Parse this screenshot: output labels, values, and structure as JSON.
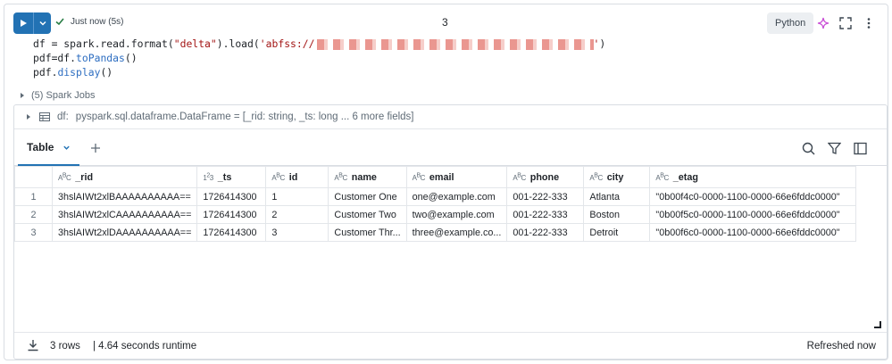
{
  "header": {
    "status": "Just now (5s)",
    "cell_number": "3",
    "language": "Python"
  },
  "code": {
    "line1_a": "df = spark.read.format(",
    "line1_str": "\"delta\"",
    "line1_b": ").load(",
    "line1_str2": "'abfss://",
    "line1_c": ")",
    "line2_a": "pdf=df.",
    "line2_fn": "toPandas",
    "line2_b": "()",
    "line3_a": "pdf.",
    "line3_fn": "display",
    "line3_b": "()"
  },
  "jobs": {
    "label": "(5) Spark Jobs"
  },
  "schema": {
    "var": "df:",
    "text": "pyspark.sql.dataframe.DataFrame = [_rid: string, _ts: long ... 6 more fields]"
  },
  "tabs": {
    "table_label": "Table"
  },
  "table": {
    "columns": [
      {
        "name": "_rid",
        "type": "string"
      },
      {
        "name": "_ts",
        "type": "number"
      },
      {
        "name": "id",
        "type": "string"
      },
      {
        "name": "name",
        "type": "string"
      },
      {
        "name": "email",
        "type": "string"
      },
      {
        "name": "phone",
        "type": "string"
      },
      {
        "name": "city",
        "type": "string"
      },
      {
        "name": "_etag",
        "type": "string"
      }
    ],
    "rows": [
      [
        "1",
        "3hslAIWt2xlBAAAAAAAAAA==",
        "1726414300",
        "1",
        "Customer One",
        "one@example.com",
        "001-222-333",
        "Atlanta",
        "\"0b00f4c0-0000-1100-0000-66e6fddc0000\""
      ],
      [
        "2",
        "3hslAIWt2xlCAAAAAAAAAA==",
        "1726414300",
        "2",
        "Customer Two",
        "two@example.com",
        "001-222-333",
        "Boston",
        "\"0b00f5c0-0000-1100-0000-66e6fddc0000\""
      ],
      [
        "3",
        "3hslAIWt2xlDAAAAAAAAAA==",
        "1726414300",
        "3",
        "Customer Thr...",
        "three@example.co...",
        "001-222-333",
        "Detroit",
        "\"0b00f6c0-0000-1100-0000-66e6fddc0000\""
      ]
    ]
  },
  "footer": {
    "rows": "3 rows",
    "runtime": "|  4.64 seconds runtime",
    "refreshed": "Refreshed now"
  },
  "colors": {
    "accent": "#2272b4",
    "success": "#277c43",
    "assistant": "#c94fd6"
  }
}
